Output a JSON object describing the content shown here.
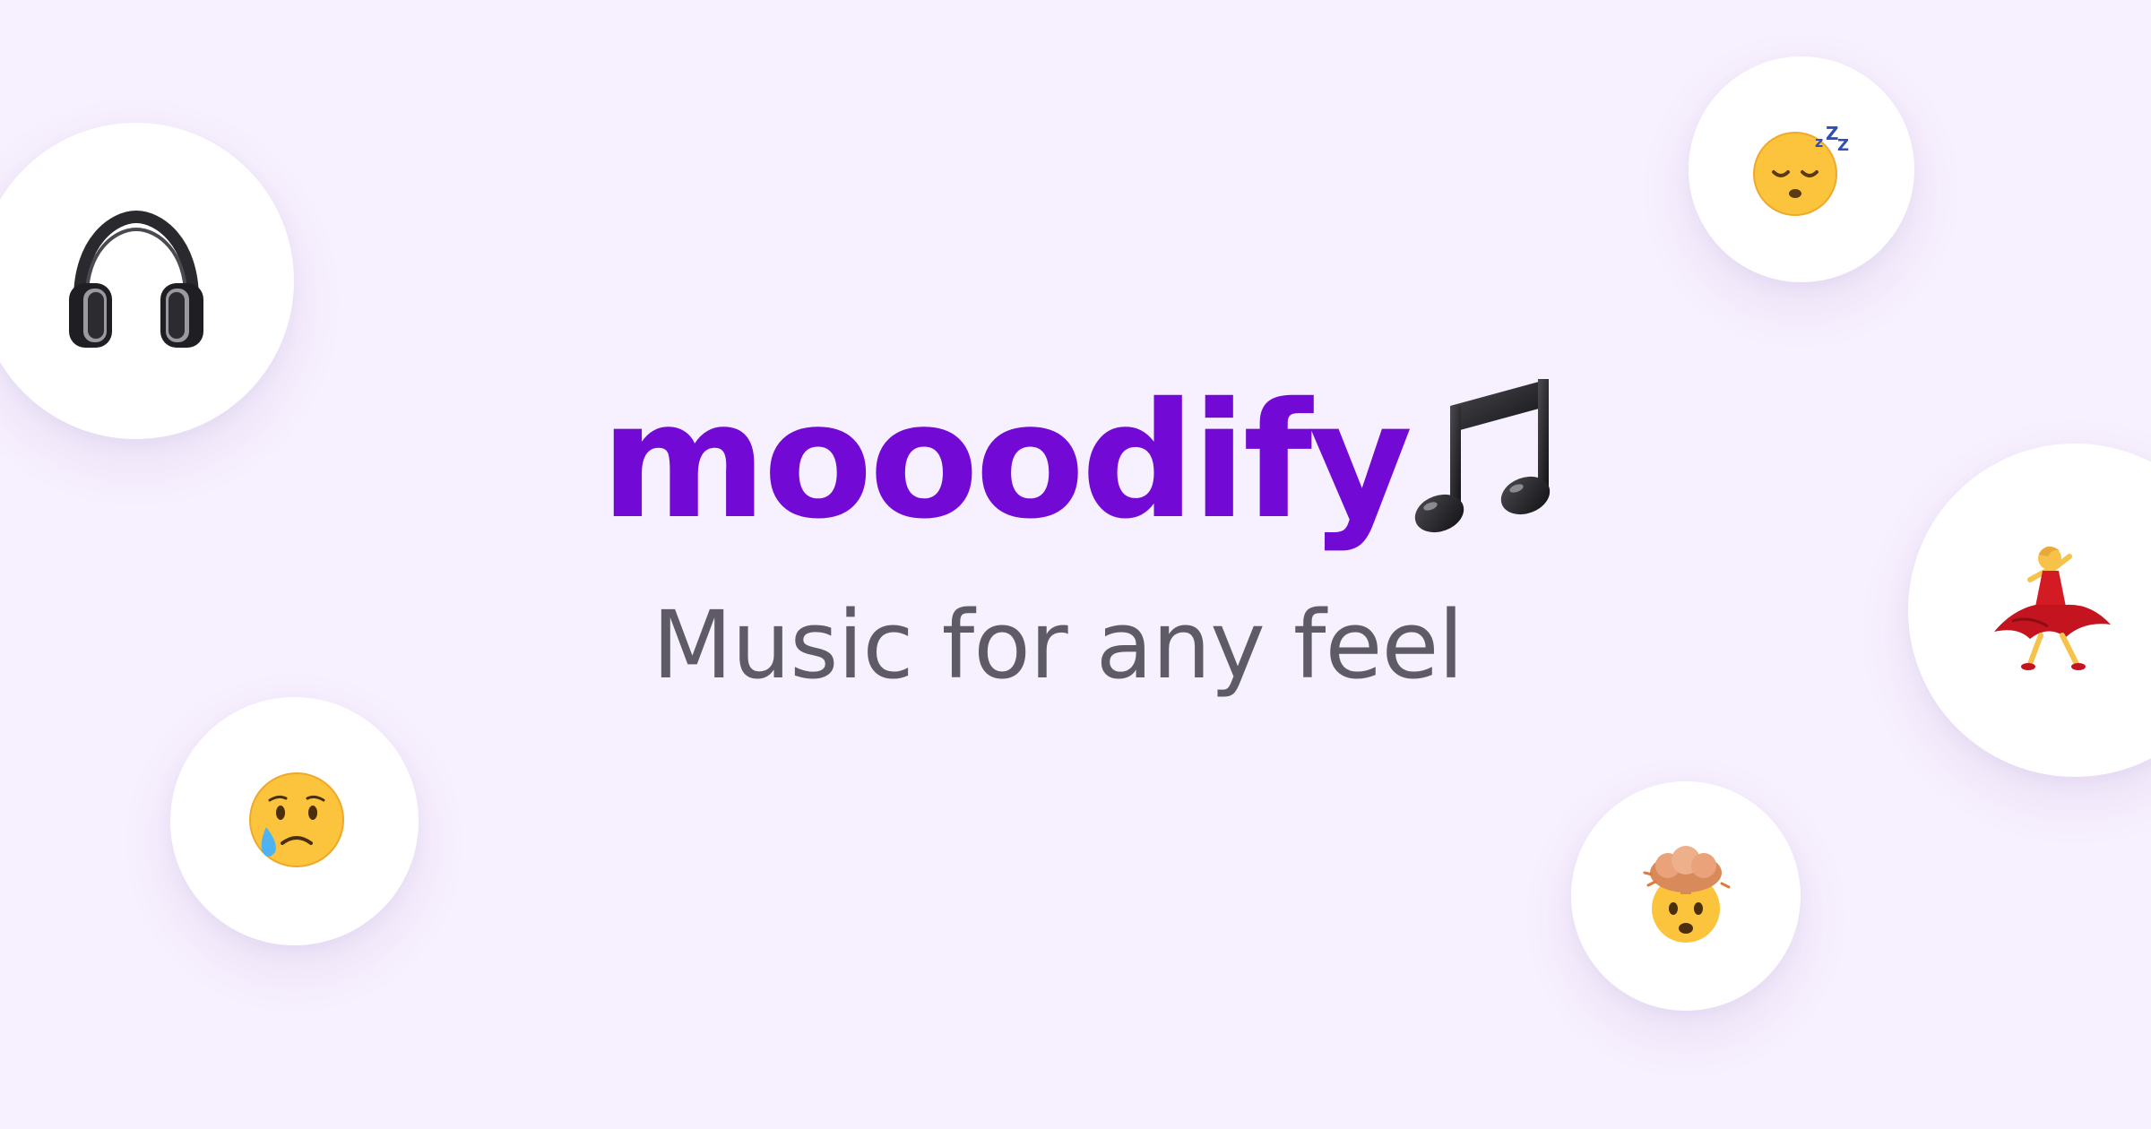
{
  "brand": {
    "name": "mooodify",
    "note_icon": "musical-notes-icon",
    "name_color": "#7209D4"
  },
  "tagline": {
    "text": "Music for any feel",
    "color": "#5E5B66"
  },
  "background_color": "#F7F0FE",
  "bubbles": [
    {
      "icon": "headphones-icon"
    },
    {
      "icon": "sleeping-face-icon"
    },
    {
      "icon": "woman-dancing-icon"
    },
    {
      "icon": "crying-face-icon"
    },
    {
      "icon": "exploding-head-icon"
    }
  ]
}
